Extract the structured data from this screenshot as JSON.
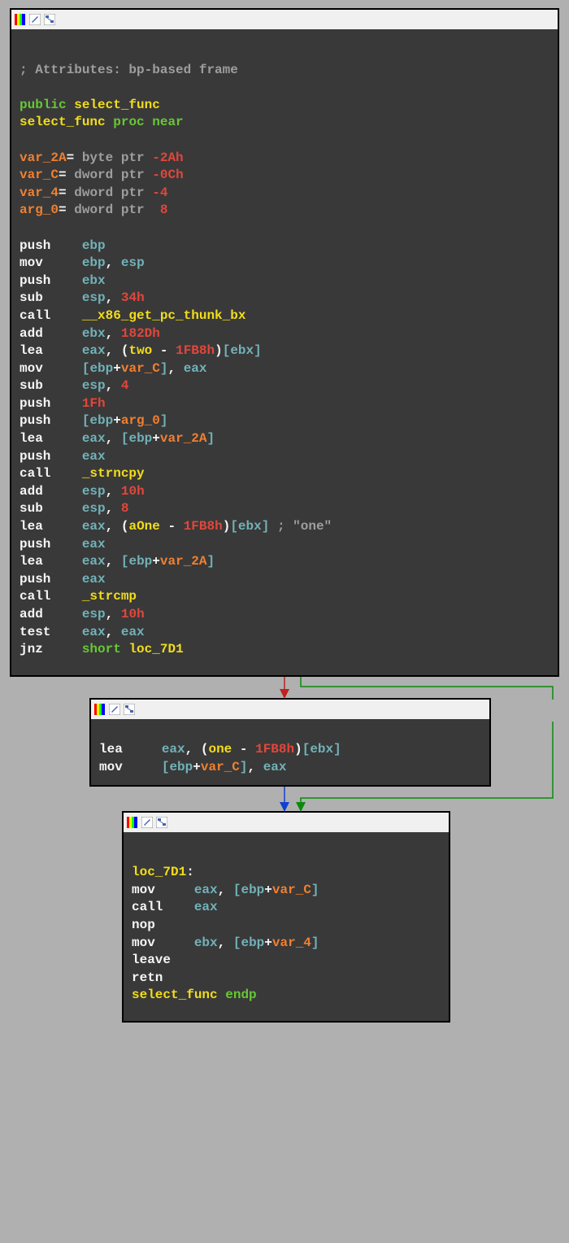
{
  "node1": {
    "comment_prefix": "; ",
    "comment": "Attributes: bp-based frame",
    "public_kw": "public",
    "func_name": "select_func",
    "proc_kw": "proc",
    "near_kw": "near",
    "vars": {
      "var_2A": {
        "name": "var_2A",
        "eq": "=",
        "type": "byte ptr",
        "val": "-2Ah"
      },
      "var_C": {
        "name": "var_C",
        "eq": "=",
        "type": "dword ptr",
        "val": "-0Ch"
      },
      "var_4": {
        "name": "var_4",
        "eq": "=",
        "type": "dword ptr",
        "val": "-4"
      },
      "arg_0": {
        "name": "arg_0",
        "eq": "=",
        "type": "dword ptr",
        "val": "8",
        "valcolor": "red"
      }
    },
    "lines": {
      "l1": {
        "op": "push",
        "r1": "ebp"
      },
      "l2": {
        "op": "mov",
        "r1": "ebp",
        "c": ",",
        "r2": "esp"
      },
      "l3": {
        "op": "push",
        "r1": "ebx"
      },
      "l4": {
        "op": "sub",
        "r1": "esp",
        "c": ",",
        "imm": "34h"
      },
      "l5": {
        "op": "call",
        "fn": "__x86_get_pc_thunk_bx"
      },
      "l6": {
        "op": "add",
        "r1": "ebx",
        "c": ",",
        "imm": "182Dh"
      },
      "l7": {
        "op": "lea",
        "r1": "eax",
        "c": ",",
        "lp": "(",
        "sym": "two",
        "sub": " - ",
        "off": "1FB8h",
        "rp": ")",
        "lb": "[",
        "r2": "ebx",
        "rb": "]"
      },
      "l8": {
        "op": "mov",
        "lb": "[",
        "r1": "ebp",
        "plus": "+",
        "var": "var_C",
        "rb": "]",
        "c": ",",
        "r2": "eax"
      },
      "l9": {
        "op": "sub",
        "r1": "esp",
        "c": ",",
        "imm": "4"
      },
      "l10": {
        "op": "push",
        "imm": "1Fh"
      },
      "l11": {
        "op": "push",
        "lb": "[",
        "r1": "ebp",
        "plus": "+",
        "var": "arg_0",
        "rb": "]"
      },
      "l12": {
        "op": "lea",
        "r1": "eax",
        "c": ",",
        "lb": "[",
        "r2": "ebp",
        "plus": "+",
        "var": "var_2A",
        "rb": "]"
      },
      "l13": {
        "op": "push",
        "r1": "eax"
      },
      "l14": {
        "op": "call",
        "fn": "_strncpy"
      },
      "l15": {
        "op": "add",
        "r1": "esp",
        "c": ",",
        "imm": "10h"
      },
      "l16": {
        "op": "sub",
        "r1": "esp",
        "c": ",",
        "imm": "8"
      },
      "l17": {
        "op": "lea",
        "r1": "eax",
        "c": ",",
        "lp": "(",
        "sym": "aOne",
        "sub": " - ",
        "off": "1FB8h",
        "rp": ")",
        "lb": "[",
        "r2": "ebx",
        "rb": "]",
        "cm": " ; \"one\""
      },
      "l18": {
        "op": "push",
        "r1": "eax"
      },
      "l19": {
        "op": "lea",
        "r1": "eax",
        "c": ",",
        "lb": "[",
        "r2": "ebp",
        "plus": "+",
        "var": "var_2A",
        "rb": "]"
      },
      "l20": {
        "op": "push",
        "r1": "eax"
      },
      "l21": {
        "op": "call",
        "fn": "_strcmp"
      },
      "l22": {
        "op": "add",
        "r1": "esp",
        "c": ",",
        "imm": "10h"
      },
      "l23": {
        "op": "test",
        "r1": "eax",
        "c": ",",
        "r2": "eax"
      },
      "l24": {
        "op": "jnz",
        "kw": "short",
        "tgt": "loc_7D1"
      }
    }
  },
  "node2": {
    "lines": {
      "l1": {
        "op": "lea",
        "r1": "eax",
        "c": ",",
        "lp": "(",
        "sym": "one",
        "sub": " - ",
        "off": "1FB8h",
        "rp": ")",
        "lb": "[",
        "r2": "ebx",
        "rb": "]"
      },
      "l2": {
        "op": "mov",
        "lb": "[",
        "r1": "ebp",
        "plus": "+",
        "var": "var_C",
        "rb": "]",
        "c": ",",
        "r2": "eax"
      }
    }
  },
  "node3": {
    "label": "loc_7D1",
    "colon": ":",
    "lines": {
      "l1": {
        "op": "mov",
        "r1": "eax",
        "c": ",",
        "lb": "[",
        "r2": "ebp",
        "plus": "+",
        "var": "var_C",
        "rb": "]"
      },
      "l2": {
        "op": "call",
        "r1": "eax"
      },
      "l3": {
        "op": "nop"
      },
      "l4": {
        "op": "mov",
        "r1": "ebx",
        "c": ",",
        "lb": "[",
        "r2": "ebp",
        "plus": "+",
        "var": "var_4",
        "rb": "]"
      },
      "l5": {
        "op": "leave"
      },
      "l6": {
        "op": "retn"
      }
    },
    "func": "select_func",
    "endp": "endp"
  }
}
